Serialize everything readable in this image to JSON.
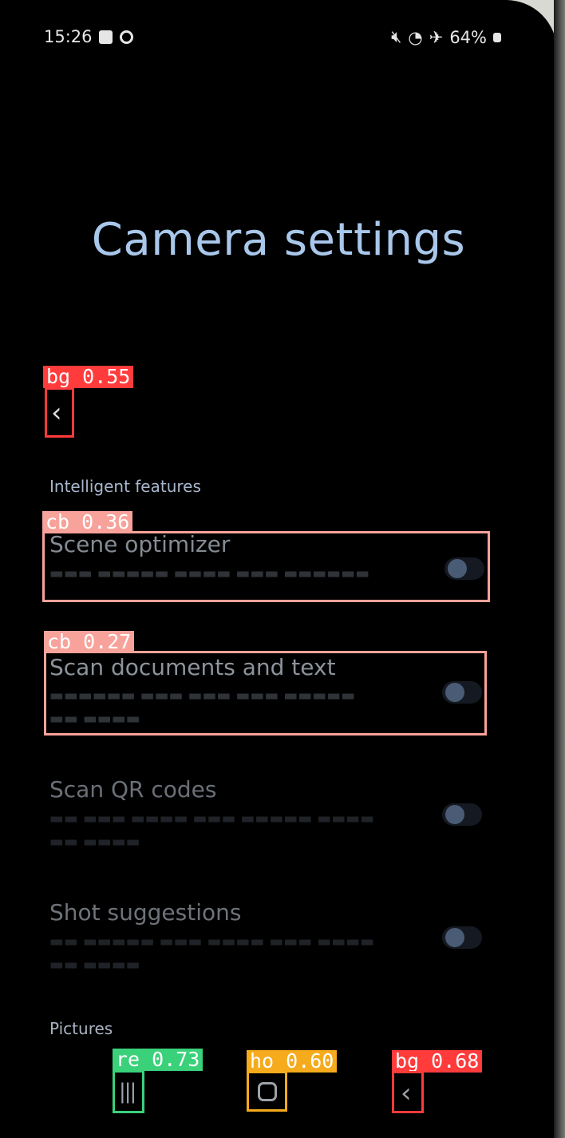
{
  "status_bar": {
    "time": "15:26",
    "battery": "64%",
    "icons": [
      "checkbox-icon",
      "clock-icon",
      "mute-icon",
      "wifi-icon",
      "airplane-icon",
      "battery-icon"
    ]
  },
  "header": {
    "title": "Camera settings"
  },
  "detections": {
    "back_top": "bg 0.55",
    "scene": "cb 0.36",
    "scan_docs": "cb 0.27",
    "recents": "re 0.73",
    "home": "ho 0.60",
    "back_nav": "bg 0.68"
  },
  "colors": {
    "back_box": "#ff3b3b",
    "checkbox_box": "#f7a29a",
    "recents_box": "#3ad17a",
    "home_box": "#f5ab1c"
  },
  "sections": {
    "intelligent": "Intelligent features",
    "pictures": "Pictures"
  },
  "items": [
    {
      "title": "Scene optimizer",
      "enabled": false
    },
    {
      "title": "Scan documents and text",
      "enabled": false
    },
    {
      "title": "Scan QR codes",
      "enabled": false
    },
    {
      "title": "Shot suggestions",
      "enabled": false
    }
  ],
  "nav": {
    "recents_icon": "recents-icon",
    "home_icon": "home-icon",
    "back_icon": "back-icon"
  }
}
